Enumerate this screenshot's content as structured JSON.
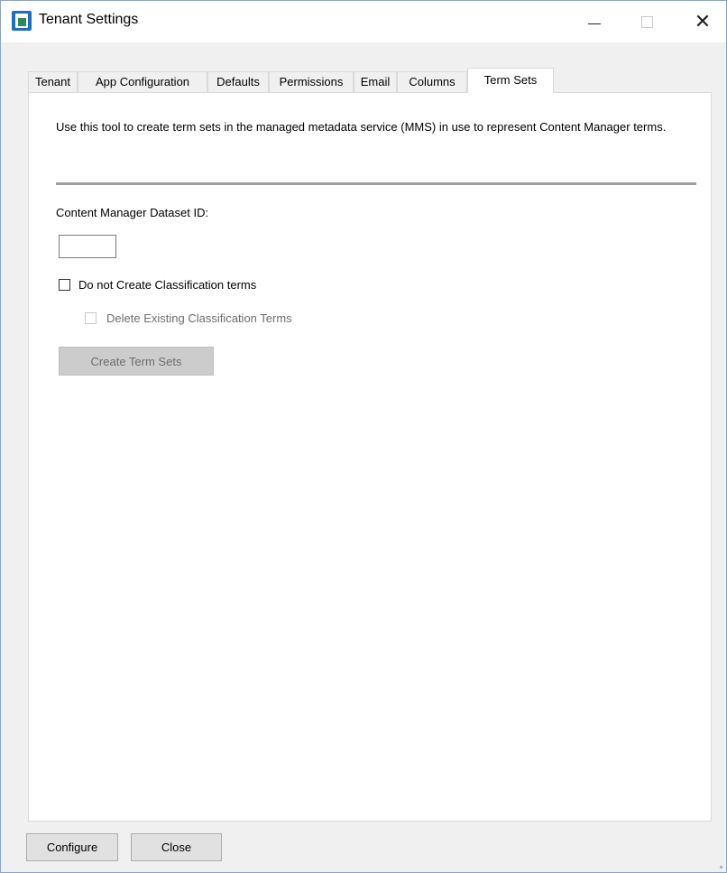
{
  "window": {
    "title": "Tenant Settings",
    "close_glyph": "✕"
  },
  "tabs": [
    {
      "label": "Tenant"
    },
    {
      "label": "App Configuration"
    },
    {
      "label": "Defaults"
    },
    {
      "label": "Permissions"
    },
    {
      "label": "Email"
    },
    {
      "label": "Columns"
    },
    {
      "label": "Term Sets",
      "active": true
    }
  ],
  "term_sets": {
    "description": "Use this tool to create term sets in the managed metadata service (MMS) in use to represent Content Manager terms.",
    "dataset_label": "Content Manager Dataset ID:",
    "dataset_value": "",
    "no_classification_label": "Do not Create Classification terms",
    "no_classification_checked": false,
    "delete_existing_label": "Delete Existing Classification Terms",
    "delete_existing_checked": false,
    "delete_existing_enabled": false,
    "create_button_label": "Create Term Sets",
    "create_button_enabled": false
  },
  "footer": {
    "configure_label": "Configure",
    "close_label": "Close"
  },
  "icons": {
    "app_icon": "app-icon",
    "minimize": "minimize-icon",
    "maximize": "maximize-icon",
    "close": "close-icon"
  }
}
